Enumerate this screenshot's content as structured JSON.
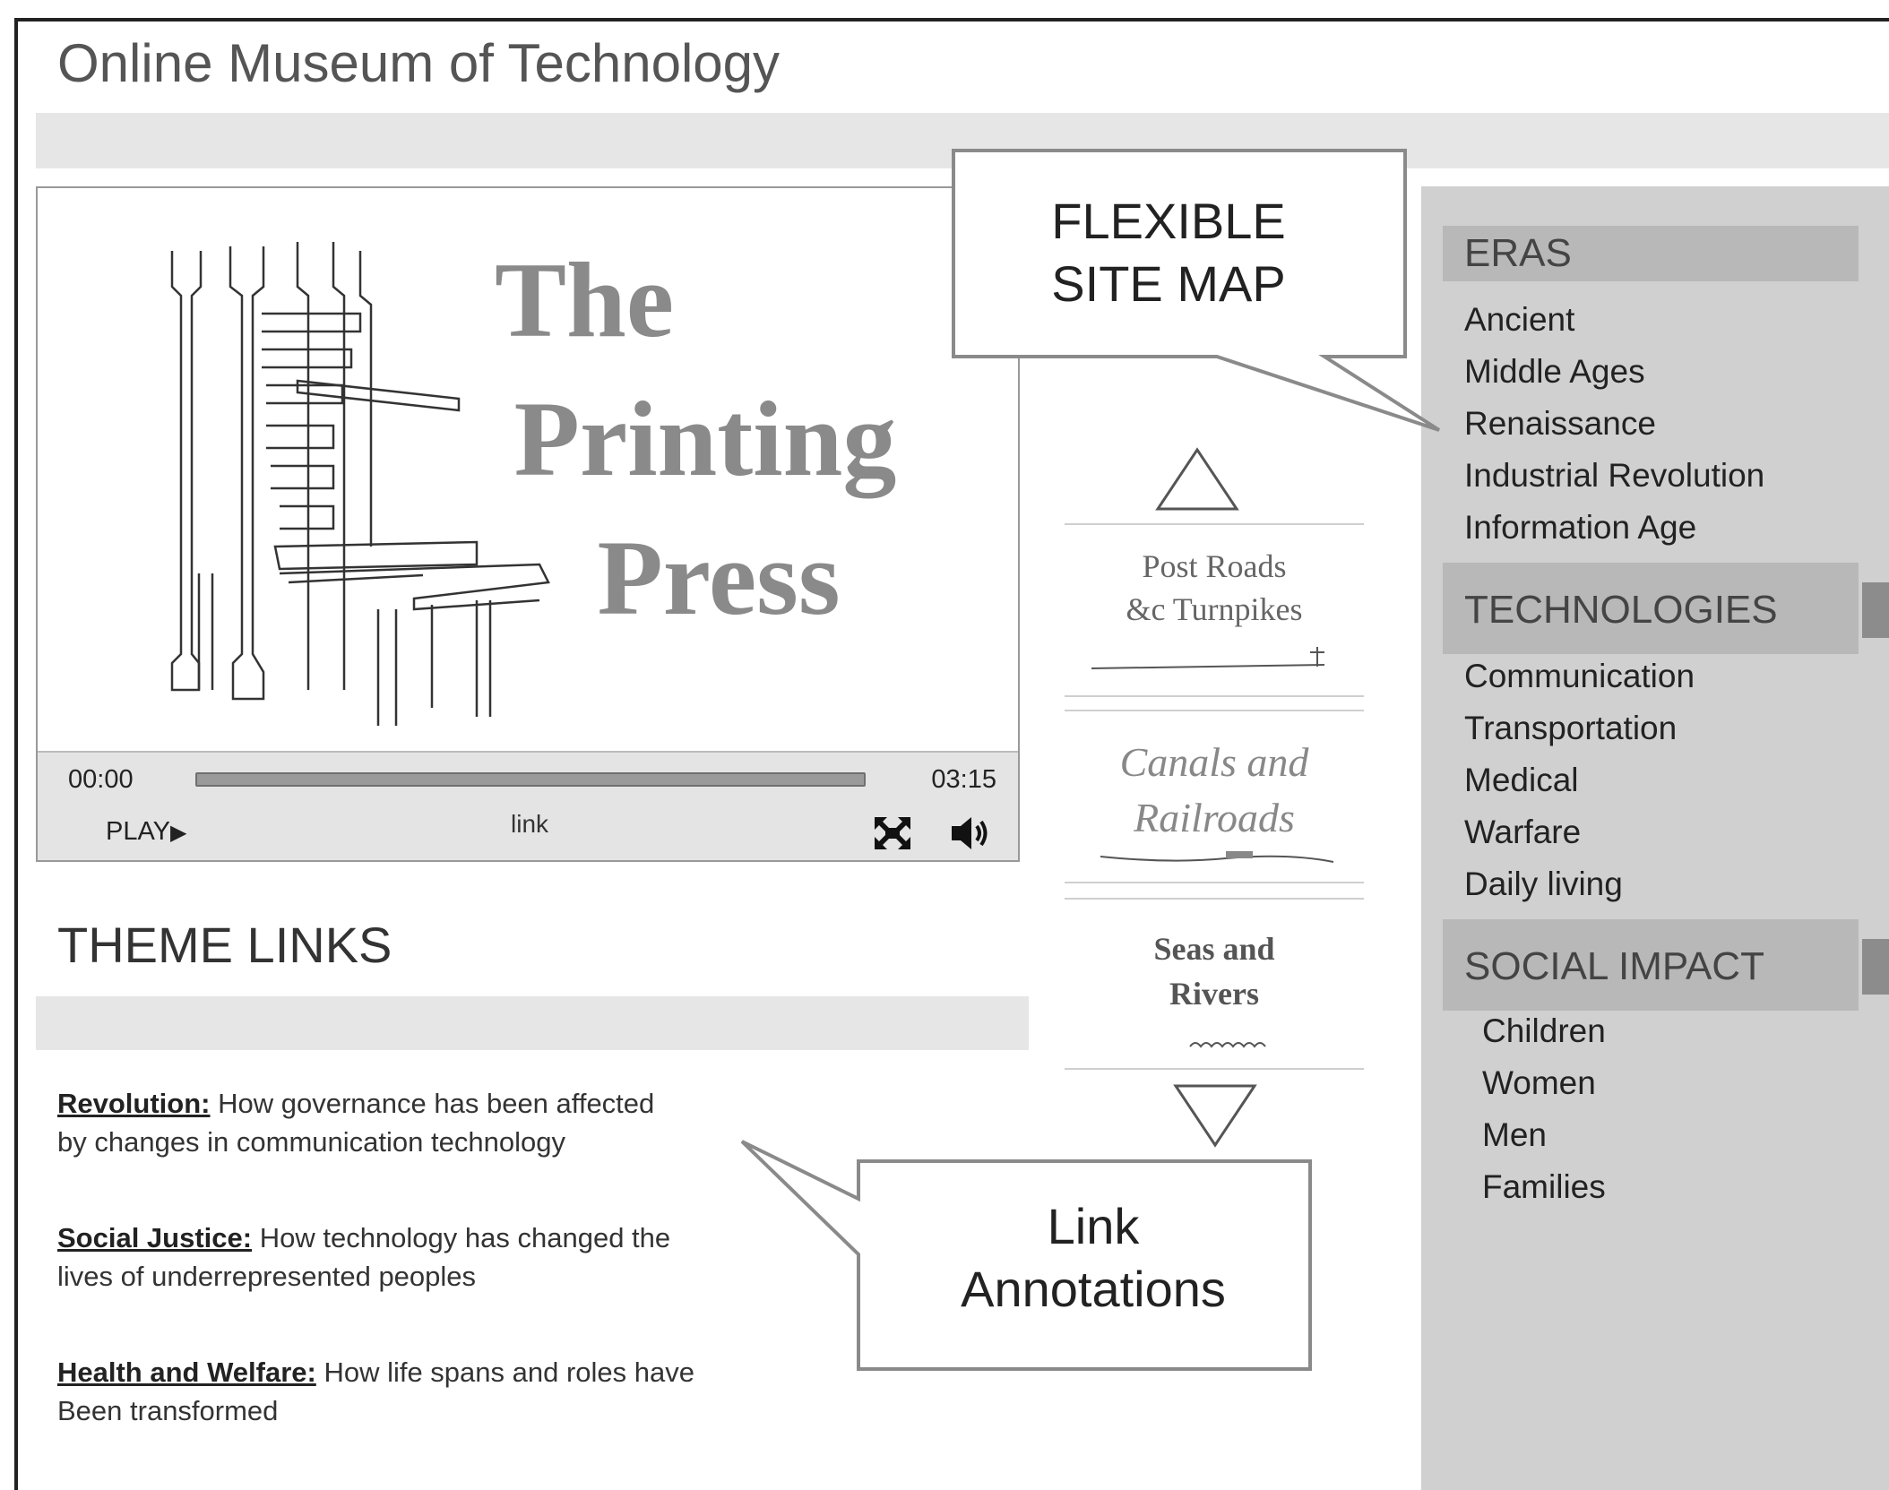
{
  "site": {
    "title": "Online Museum of Technology"
  },
  "player": {
    "title_words": [
      "The",
      "Printing",
      "Press"
    ],
    "time_current": "00:00",
    "time_total": "03:15",
    "progress": 0,
    "play_label": "PLAY",
    "play_glyph": "▶",
    "link_label": "link",
    "fullscreen_icon": "fullscreen-icon",
    "volume_icon": "speaker-icon"
  },
  "carousel": {
    "cards": [
      {
        "line1": "Post Roads",
        "line2": "&c Turnpikes"
      },
      {
        "line1": "Canals and",
        "line2": "Railroads"
      },
      {
        "line1": "Seas and",
        "line2": "Rivers"
      }
    ]
  },
  "theme": {
    "heading": "THEME LINKS",
    "items": [
      {
        "title": "Revolution:",
        "desc1": " How governance has been affected",
        "desc2": " by changes in communication technology"
      },
      {
        "title": "Social Justice:",
        "desc1": " How technology has changed the",
        "desc2": "lives of underrepresented peoples"
      },
      {
        "title": "Health and Welfare:",
        "desc1": " How life spans and roles have",
        "desc2": "Been transformed"
      }
    ]
  },
  "sidebar": {
    "eras": {
      "label": "ERAS",
      "items": [
        "Ancient",
        "Middle Ages",
        "Renaissance",
        "Industrial Revolution",
        "Information Age"
      ]
    },
    "technologies": {
      "label": "TECHNOLOGIES",
      "items": [
        "Communication",
        "Transportation",
        "Medical",
        "Warfare",
        "Daily  living"
      ]
    },
    "social": {
      "label": "SOCIAL IMPACT",
      "items": [
        "Children",
        "Women",
        "Men",
        "Families"
      ]
    }
  },
  "callouts": {
    "site_map": {
      "line1": "FLEXIBLE",
      "line2": "SITE MAP"
    },
    "link_annotations": {
      "line1": "Link",
      "line2": "Annotations"
    }
  },
  "colors": {
    "panel": "#d0d0d0",
    "category": "#b8b8b8",
    "bar": "#e6e6e6",
    "accent_tab": "#8c8c8c"
  }
}
